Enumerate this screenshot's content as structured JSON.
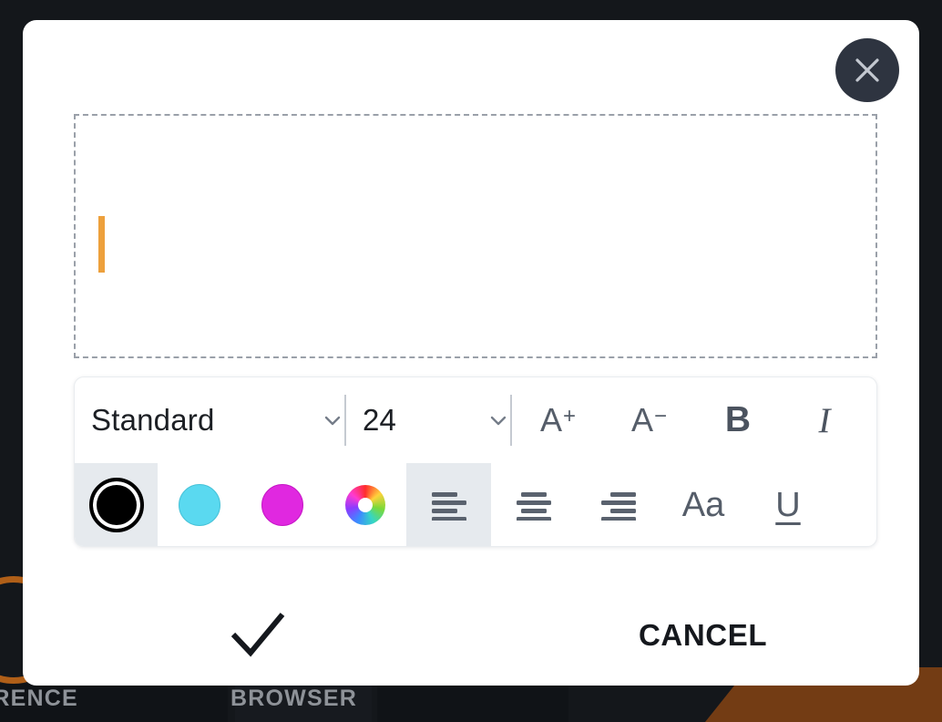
{
  "backdrop": {
    "labels": [
      "FERENCE",
      "BROWSER"
    ],
    "accent_color": "#b05f18",
    "surface_color": "#14171b"
  },
  "modal": {
    "close_button": {
      "icon": "close-x-icon",
      "label": "Close"
    },
    "text_area": {
      "value": "",
      "placeholder": "",
      "caret_color": "#eda03c",
      "border_style": "dashed"
    },
    "toolbar": {
      "font_family": {
        "label": "Standard",
        "value": "Standard",
        "icon": "chevron-down-icon"
      },
      "font_size": {
        "label": "24",
        "value": "24",
        "icon": "chevron-down-icon"
      },
      "increase_size": {
        "label": "A",
        "sup": "+",
        "icon": "font-increase-icon"
      },
      "decrease_size": {
        "label": "A",
        "sup": "−",
        "icon": "font-decrease-icon"
      },
      "bold": {
        "label": "B",
        "icon": "bold-icon",
        "active": false
      },
      "italic": {
        "label": "I",
        "icon": "italic-icon",
        "active": false
      },
      "colors": [
        {
          "name": "black",
          "hex": "#000000",
          "selected": true
        },
        {
          "name": "cyan",
          "hex": "#5ad9f0",
          "selected": false
        },
        {
          "name": "magenta",
          "hex": "#e028e0",
          "selected": false
        },
        {
          "name": "color-wheel",
          "hex": "",
          "selected": false
        }
      ],
      "alignments": [
        {
          "name": "align-left",
          "selected": true
        },
        {
          "name": "align-center",
          "selected": false
        },
        {
          "name": "align-right",
          "selected": false
        }
      ],
      "text_case": {
        "label": "Aa",
        "icon": "text-case-icon"
      },
      "underline": {
        "label": "U",
        "icon": "underline-icon",
        "active": false
      }
    },
    "footer": {
      "confirm": {
        "label": "",
        "icon": "checkmark-icon"
      },
      "cancel": {
        "label": "CANCEL"
      }
    }
  }
}
